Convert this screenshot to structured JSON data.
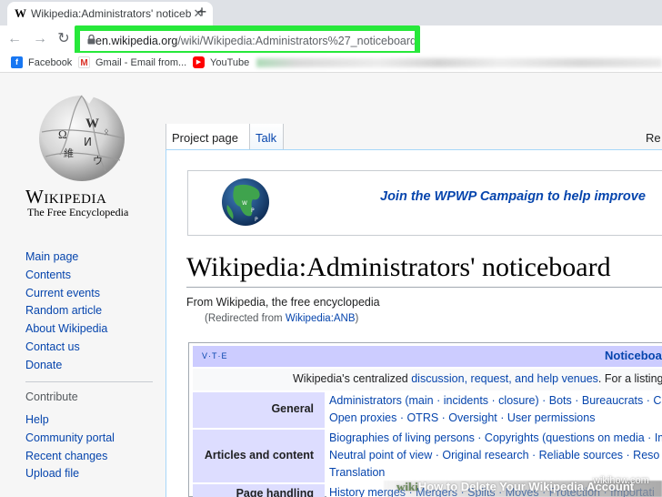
{
  "browser": {
    "tab_title": "Wikipedia:Administrators' noticeboard",
    "tab_favicon": "W",
    "new_tab": "+",
    "url_host": "en.wikipedia.org",
    "url_path": "/wiki/Wikipedia:Administrators%27_noticeboard",
    "highlight_color": "#27e83a",
    "bookmarks": [
      "Facebook",
      "Gmail - Email from...",
      "YouTube"
    ]
  },
  "sidebar": {
    "wordmark": "Wikipedia",
    "tagline": "The Free Encyclopedia",
    "nav": [
      "Main page",
      "Contents",
      "Current events",
      "Random article",
      "About Wikipedia",
      "Contact us",
      "Donate"
    ],
    "contribute_heading": "Contribute",
    "contribute": [
      "Help",
      "Community portal",
      "Recent changes",
      "Upload file"
    ]
  },
  "page_tabs": {
    "project": "Project page",
    "talk": "Talk",
    "read": "Re"
  },
  "banner": {
    "text": "Join the WPWP Campaign to help improve"
  },
  "article": {
    "title": "Wikipedia:Administrators' noticeboard",
    "from": "From Wikipedia, the free encyclopedia",
    "redirect_prefix": "(Redirected from ",
    "redirect_link": "Wikipedia:ANB",
    "redirect_suffix": ")"
  },
  "navbox": {
    "vte": "V·T·E",
    "heading": "Noticeboa",
    "intro_prefix": "Wikipedia's centralized ",
    "intro_links": "discussion, request, and help venues",
    "intro_suffix": ". For a listing",
    "rows": [
      {
        "group": "General",
        "line1": "Administrators (main · incidents · closure) · Bots · Bureaucrats · C",
        "line2": "Open proxies · OTRS · Oversight · User permissions"
      },
      {
        "group": "Articles and content",
        "line1": "Biographies of living persons · Copyrights (questions on media · Importati",
        "line2": "Neutral point of view · Original research · Reliable sources · Reso",
        "line3": "Translation"
      },
      {
        "group": "Page handling",
        "line1": "History merges · Mergers · Splits · Moves · Protection · Importati"
      }
    ]
  },
  "watermark": {
    "wiki": "wiki",
    "text": "How to Delete Your Wikipedia Account",
    "site": "wikihow.com"
  }
}
